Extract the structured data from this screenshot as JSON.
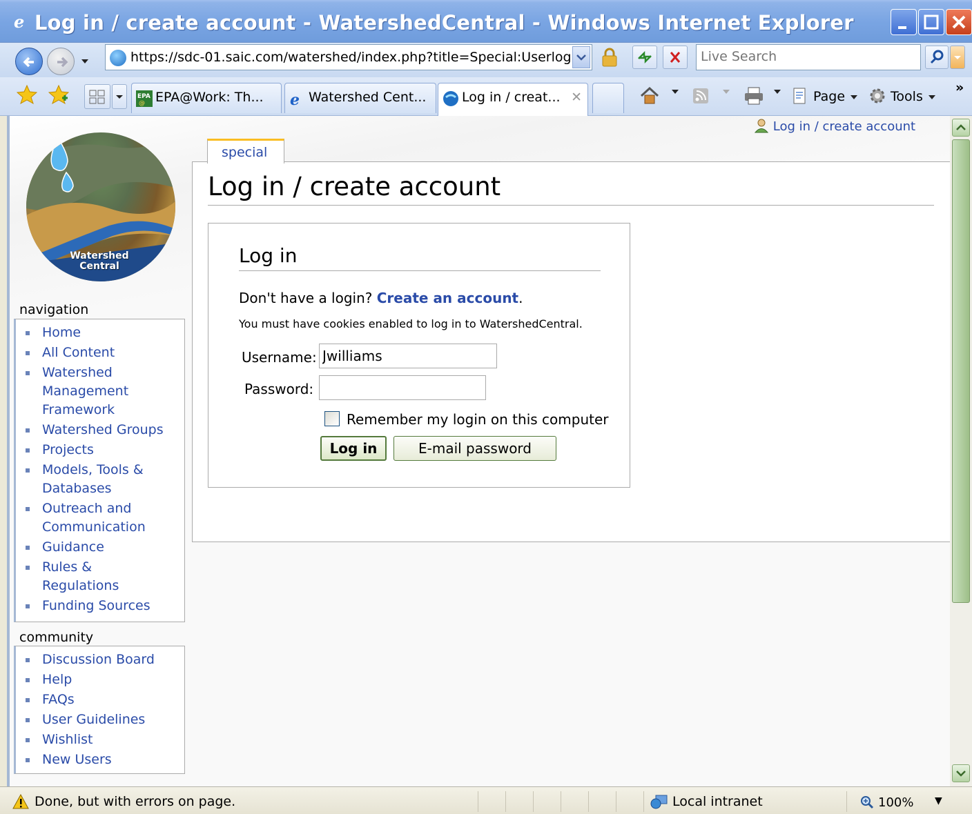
{
  "window": {
    "title": "Log in / create account - WatershedCentral - Windows Internet Explorer"
  },
  "address_bar": {
    "url": "https://sdc-01.saic.com/watershed/index.php?title=Special:Userlog"
  },
  "search": {
    "placeholder": "Live Search"
  },
  "tabs": [
    {
      "label": "EPA@Work: Th...",
      "icon": "epa-icon"
    },
    {
      "label": "Watershed Cent...",
      "icon": "ie-icon"
    },
    {
      "label": "Log in / creat...",
      "icon": "ie-icon",
      "active": true
    }
  ],
  "command_bar": {
    "page_label": "Page",
    "tools_label": "Tools"
  },
  "wiki": {
    "personal_link": "Log in / create account",
    "logo_text_line1": "Watershed",
    "logo_text_line2": "Central",
    "navigation_title": "navigation",
    "navigation_items": [
      "Home",
      "All Content",
      "Watershed Management Framework",
      "Watershed Groups",
      "Projects",
      "Models, Tools & Databases",
      "Outreach and Communication",
      "Guidance",
      "Rules & Regulations",
      "Funding Sources"
    ],
    "community_title": "community",
    "community_items": [
      "Discussion Board",
      "Help",
      "FAQs",
      "User Guidelines",
      "Wishlist",
      "New Users"
    ],
    "special_tab": "special",
    "page_heading": "Log in / create account"
  },
  "login_form": {
    "legend": "Log in",
    "no_login_text": "Don't have a login? ",
    "create_account_link": "Create an account",
    "create_account_period": ".",
    "cookies_note": "You must have cookies enabled to log in to WatershedCentral.",
    "username_label": "Username:",
    "username_value": "Jwilliams",
    "password_label": "Password:",
    "password_value": "",
    "remember_label": "Remember my login on this computer",
    "remember_checked": false,
    "login_button": "Log in",
    "email_password_button": "E-mail password"
  },
  "status_bar": {
    "status": "Done, but with errors on page.",
    "zone": "Local intranet",
    "zoom": "100%"
  },
  "colors": {
    "link": "#2a4ba8",
    "title_bar": "#7aa5e3",
    "special_tab_accent": "#fabd23"
  }
}
